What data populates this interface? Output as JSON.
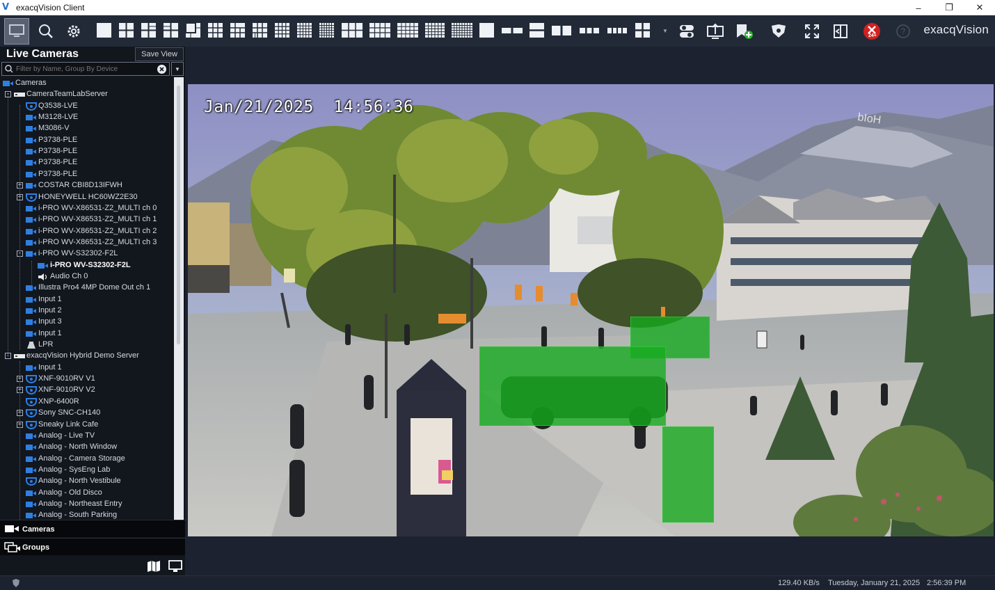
{
  "window": {
    "title": "exacqVision Client",
    "minimize": "–",
    "maximize": "❐",
    "close": "✕"
  },
  "toolbar": {
    "brand": "exacqVision",
    "badge": "24+"
  },
  "sidebar": {
    "title": "Live Cameras",
    "save_view": "Save View",
    "filter_placeholder": "Filter by Name, Group By Device",
    "tree": [
      {
        "label": "Cameras",
        "icon": "camera-icon"
      },
      {
        "label": "CameraTeamLabServer",
        "icon": "server-icon"
      },
      {
        "label": "Q3538-LVE",
        "icon": "dome-camera-icon"
      },
      {
        "label": "M3128-LVE",
        "icon": "camera-icon"
      },
      {
        "label": "M3086-V",
        "icon": "camera-icon"
      },
      {
        "label": "P3738-PLE",
        "icon": "camera-icon"
      },
      {
        "label": "P3738-PLE",
        "icon": "camera-icon"
      },
      {
        "label": "P3738-PLE",
        "icon": "camera-icon"
      },
      {
        "label": "P3738-PLE",
        "icon": "camera-icon"
      },
      {
        "label": "COSTAR CBI8D13IFWH",
        "icon": "camera-icon"
      },
      {
        "label": "HONEYWELL HC60WZ2E30",
        "icon": "dome-camera-icon"
      },
      {
        "label": "i-PRO WV-X86531-Z2_MULTI ch 0",
        "icon": "camera-icon"
      },
      {
        "label": "i-PRO WV-X86531-Z2_MULTI ch 1",
        "icon": "camera-icon"
      },
      {
        "label": "i-PRO WV-X86531-Z2_MULTI ch 2",
        "icon": "camera-icon"
      },
      {
        "label": "i-PRO WV-X86531-Z2_MULTI ch 3",
        "icon": "camera-icon"
      },
      {
        "label": "i-PRO WV-S32302-F2L",
        "icon": "camera-icon"
      },
      {
        "label": "i-PRO WV-S32302-F2L",
        "icon": "camera-icon"
      },
      {
        "label": "Audio Ch 0",
        "icon": "speaker-icon"
      },
      {
        "label": "Illustra Pro4 4MP Dome Out ch 1",
        "icon": "camera-icon"
      },
      {
        "label": "Input 1",
        "icon": "camera-icon"
      },
      {
        "label": "Input 2",
        "icon": "camera-icon"
      },
      {
        "label": "Input 3",
        "icon": "camera-icon"
      },
      {
        "label": "Input 1",
        "icon": "camera-icon"
      },
      {
        "label": "LPR",
        "icon": "lpr-icon"
      },
      {
        "label": "exacqVision Hybrid Demo Server",
        "icon": "server-icon"
      },
      {
        "label": "Input 1",
        "icon": "camera-icon"
      },
      {
        "label": "XNF-9010RV V1",
        "icon": "dome-camera-icon"
      },
      {
        "label": "XNF-9010RV V2",
        "icon": "dome-camera-icon"
      },
      {
        "label": "XNP-6400R",
        "icon": "dome-camera-icon"
      },
      {
        "label": "Sony SNC-CH140",
        "icon": "dome-camera-icon"
      },
      {
        "label": "Sneaky Link Cafe",
        "icon": "dome-camera-icon"
      },
      {
        "label": "Analog - Live TV",
        "icon": "camera-icon"
      },
      {
        "label": "Analog - North Window",
        "icon": "camera-icon"
      },
      {
        "label": "Analog - Camera Storage",
        "icon": "camera-icon"
      },
      {
        "label": "Analog - SysEng Lab",
        "icon": "camera-icon"
      },
      {
        "label": "Analog - North Vestibule",
        "icon": "dome-camera-icon"
      },
      {
        "label": "Analog - Old Disco",
        "icon": "camera-icon"
      },
      {
        "label": "Analog - Northeast Entry",
        "icon": "camera-icon"
      },
      {
        "label": "Analog - South Parking",
        "icon": "camera-icon"
      }
    ],
    "tabs": {
      "cameras": "Cameras",
      "groups": "Groups"
    }
  },
  "video": {
    "timestamp": "Jan/21/2025  14:56:36",
    "watermark": "bIoH"
  },
  "status": {
    "bandwidth": "129.40 KB/s",
    "date": "Tuesday, January 21, 2025",
    "time": "2:56:39 PM"
  },
  "colors": {
    "detection": "#14aa1e",
    "toolbar_bg": "#222a38",
    "panel_bg": "#12161d",
    "accent_blue": "#2f7fe0"
  }
}
